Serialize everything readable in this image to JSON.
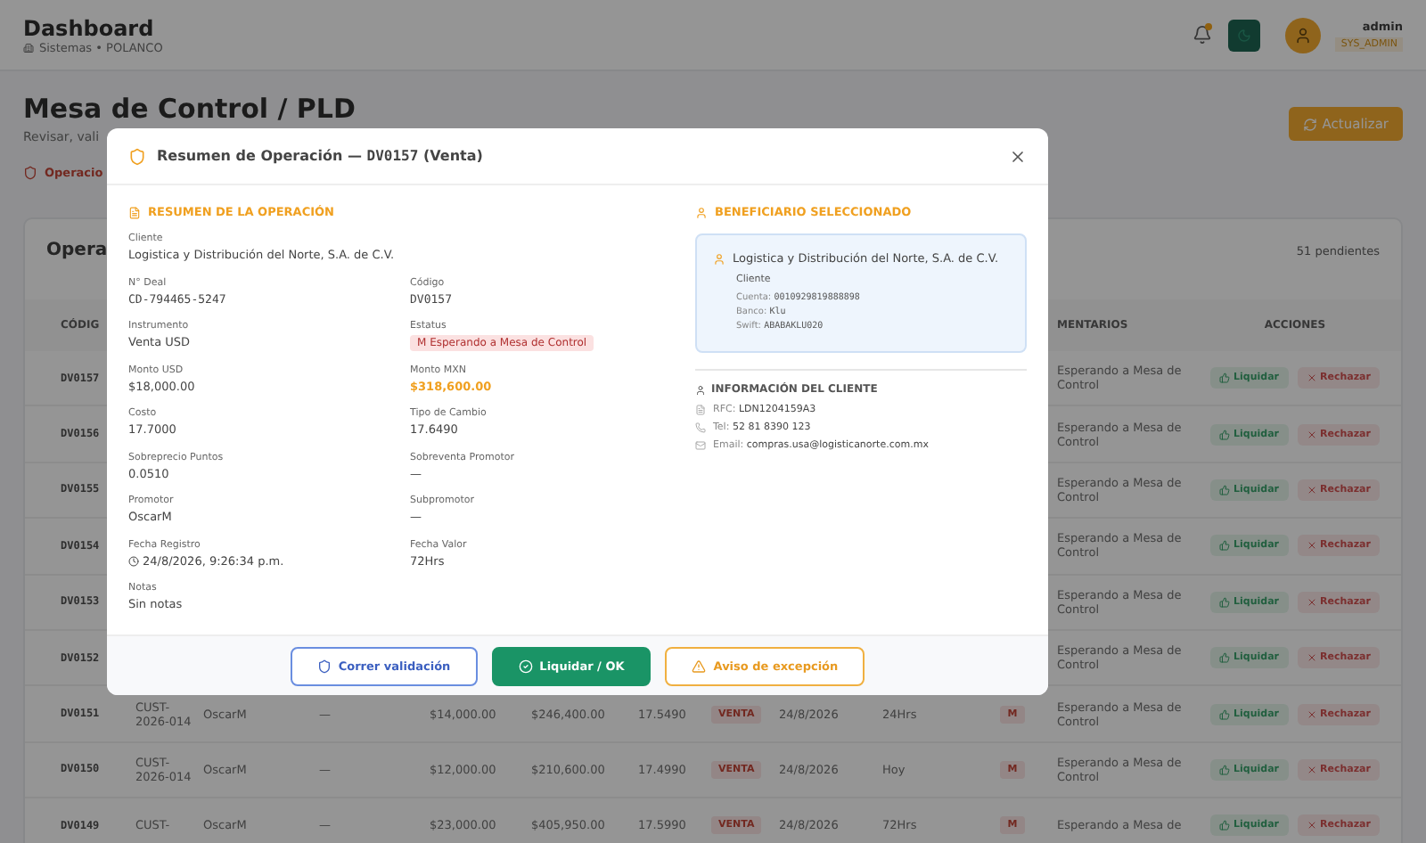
{
  "header": {
    "title": "Dashboard",
    "subtitle": "Sistemas • POLANCO",
    "notification": true,
    "user": {
      "name": "admin",
      "role": "SYS_ADMIN"
    }
  },
  "page": {
    "title": "Mesa de Control / PLD",
    "subtitle": "Revisar, vali",
    "refresh": "Actualizar",
    "alert": "Operacio"
  },
  "card": {
    "title": "Opera",
    "count": "51 pendientes"
  },
  "columns": [
    {
      "kind": "code",
      "label": "CÓDIG"
    },
    {
      "kind": "comment",
      "label": "MENTARIOS"
    },
    {
      "kind": "actions",
      "label": "ACCIONES"
    }
  ],
  "rows": [
    {
      "code": "DV0157",
      "comment": "Esperando a Mesa de Control",
      "liquidar": "Liquidar",
      "rechazar": "Rechazar"
    },
    {
      "code": "DV0156",
      "comment": "Esperando a Mesa de Control",
      "liquidar": "Liquidar",
      "rechazar": "Rechazar"
    },
    {
      "code": "DV0155",
      "comment": "Esperando a Mesa de Control",
      "liquidar": "Liquidar",
      "rechazar": "Rechazar"
    },
    {
      "code": "DV0154",
      "comment": "Esperando a Mesa de Control",
      "liquidar": "Liquidar",
      "rechazar": "Rechazar"
    },
    {
      "code": "DV0153",
      "comment": "Esperando a Mesa de Control",
      "liquidar": "Liquidar",
      "rechazar": "Rechazar"
    },
    {
      "code": "DV0152",
      "comment": "Esperando a Mesa de Control",
      "liquidar": "Liquidar",
      "rechazar": "Rechazar"
    },
    {
      "code": "DV0151",
      "client": "CUST-2026-014",
      "promoter": "OscarM",
      "subpromoter": "—",
      "usd": "$14,000.00",
      "mxn": "$246,400.00",
      "rate": "17.5490",
      "type": "VENTA",
      "date": "24/8/2026",
      "value_date": "24Hrs",
      "flag": "M",
      "comment": "Esperando a Mesa de Control",
      "liquidar": "Liquidar",
      "rechazar": "Rechazar"
    },
    {
      "code": "DV0150",
      "client": "CUST-2026-014",
      "promoter": "OscarM",
      "subpromoter": "—",
      "usd": "$12,000.00",
      "mxn": "$210,600.00",
      "rate": "17.4990",
      "type": "VENTA",
      "date": "24/8/2026",
      "value_date": "Hoy",
      "flag": "M",
      "comment": "Esperando a Mesa de Control",
      "liquidar": "Liquidar",
      "rechazar": "Rechazar"
    },
    {
      "code": "DV0149",
      "client": "CUST-",
      "promoter": "OscarM",
      "subpromoter": "—",
      "usd": "$23,000.00",
      "mxn": "$405,950.00",
      "rate": "17.5990",
      "type": "VENTA",
      "date": "24/8/2026",
      "value_date": "72Hrs",
      "flag": "M",
      "comment": "Esperando a Mesa de",
      "liquidar": "Liquidar",
      "rechazar": "Rechazar"
    }
  ],
  "modal": {
    "title": "Resumen de Operación —",
    "code": "DV0157",
    "suffix": "(Venta)",
    "summary_heading": "RESUMEN DE LA OPERACIÓN",
    "client": {
      "label": "Cliente",
      "value": "Logistica y Distribución del Norte, S.A. de C.V."
    },
    "fields": [
      {
        "label": "N° Deal",
        "value": "CD-794465-5247",
        "kind": "mono"
      },
      {
        "label": "Código",
        "value": "DV0157",
        "kind": "mono"
      },
      {
        "label": "Instrumento",
        "value": "Venta USD",
        "kind": "text"
      },
      {
        "label": "Estatus",
        "value": "M Esperando a Mesa de Control",
        "kind": "badge"
      },
      {
        "label": "Monto USD",
        "value": "$18,000.00",
        "kind": "text"
      },
      {
        "label": "Monto MXN",
        "value": "$318,600.00",
        "kind": "highlight"
      },
      {
        "label": "Costo",
        "value": "17.7000",
        "kind": "text"
      },
      {
        "label": "Tipo de Cambio",
        "value": "17.6490",
        "kind": "text"
      },
      {
        "label": "Sobreprecio Puntos",
        "value": "0.0510",
        "kind": "text"
      },
      {
        "label": "Sobreventa Promotor",
        "value": "—",
        "kind": "text"
      },
      {
        "label": "Promotor",
        "value": "OscarM",
        "kind": "text"
      },
      {
        "label": "Subpromotor",
        "value": "—",
        "kind": "text"
      },
      {
        "label": "Fecha Registro",
        "value": "24/8/2026, 9:26:34 p.m.",
        "kind": "time"
      },
      {
        "label": "Fecha Valor",
        "value": "72Hrs",
        "kind": "text"
      }
    ],
    "notes": {
      "label": "Notas",
      "value": "Sin notas"
    },
    "beneficiary_heading": "BENEFICIARIO SELECCIONADO",
    "beneficiary": {
      "name": "Logistica y Distribución del Norte, S.A. de C.V.",
      "type": "Cliente",
      "details": [
        {
          "label": "Cuenta:",
          "value": "0010929819888898"
        },
        {
          "label": "Banco:",
          "value": "Klu"
        },
        {
          "label": "Swift:",
          "value": "ABABAKLU020"
        }
      ]
    },
    "client_info_heading": "INFORMACIÓN DEL CLIENTE",
    "client_info": [
      {
        "kind": "rfc",
        "label": "RFC:",
        "value": "LDN1204159A3"
      },
      {
        "kind": "phone",
        "label": "Tel:",
        "value": "52 81 8390 123"
      },
      {
        "kind": "email",
        "label": "Email:",
        "value": "compras.usa@logisticanorte.com.mx"
      }
    ],
    "buttons": [
      {
        "kind": "outline",
        "label": "Correr validación"
      },
      {
        "kind": "primary",
        "label": "Liquidar / OK"
      },
      {
        "kind": "warning",
        "label": "Aviso de excepción"
      }
    ]
  }
}
